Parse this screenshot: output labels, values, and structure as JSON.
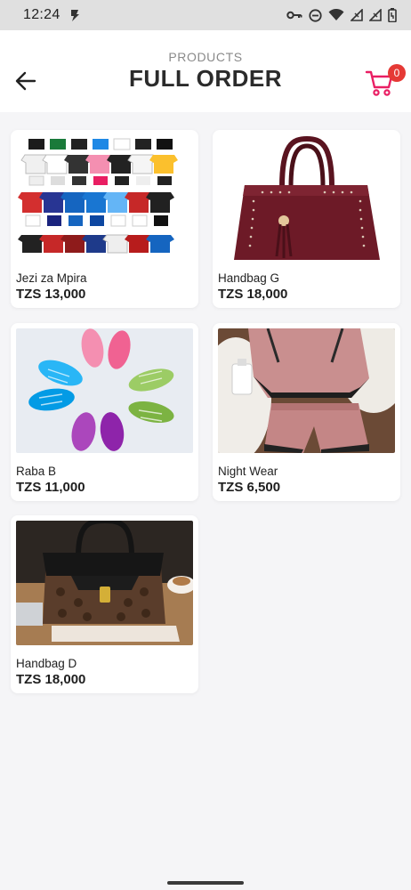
{
  "status_bar": {
    "time": "12:24",
    "icons": [
      "s-app-icon",
      "key-icon",
      "do-not-disturb-icon",
      "wifi-icon",
      "signal-icon",
      "signal-icon",
      "battery-icon"
    ]
  },
  "header": {
    "subtitle": "PRODUCTS",
    "title": "FULL ORDER",
    "back_icon": "arrow-left-icon",
    "cart_icon": "shopping-cart-icon",
    "cart_count": "0"
  },
  "colors": {
    "accent": "#e91e63",
    "badge": "#e53935",
    "background": "#f5f5f7"
  },
  "products": [
    {
      "name": "Jezi za Mpira",
      "price": "TZS 13,000",
      "image": "football-jerseys"
    },
    {
      "name": "Handbag G",
      "price": "TZS 18,000",
      "image": "maroon-handbag"
    },
    {
      "name": "Raba B",
      "price": "TZS 11,000",
      "image": "kids-sandals"
    },
    {
      "name": "Night Wear",
      "price": "TZS 6,500",
      "image": "satin-nightwear"
    },
    {
      "name": "Handbag D",
      "price": "TZS 18,000",
      "image": "brown-black-handbag"
    }
  ]
}
